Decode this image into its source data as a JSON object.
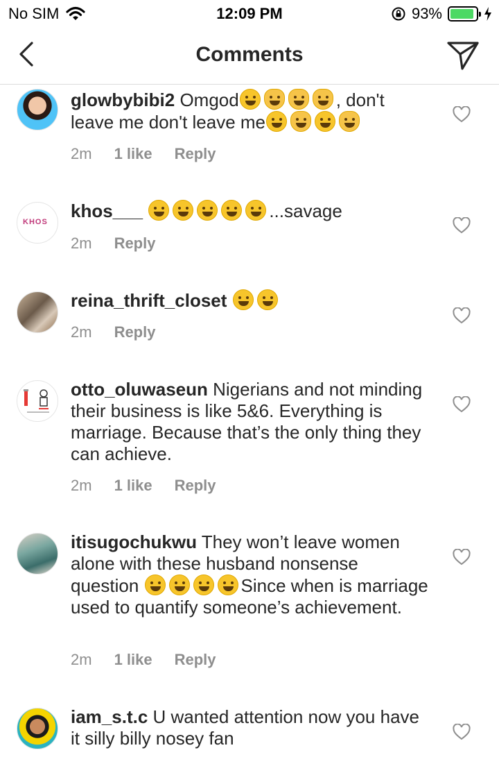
{
  "status_bar": {
    "carrier": "No SIM",
    "time": "12:09 PM",
    "battery_percent": "93%",
    "battery_level": 0.93,
    "battery_color": "#4cd964",
    "icons": [
      "wifi-icon",
      "rotation-lock-icon",
      "battery-icon",
      "charging-bolt-icon"
    ]
  },
  "header": {
    "title": "Comments",
    "back_icon": "chevron-left-icon",
    "send_icon": "paper-plane-icon"
  },
  "colors": {
    "text": "#262626",
    "meta": "#8e8e8e",
    "divider": "#dbdbdb"
  },
  "comments": [
    {
      "username": "glowbybibi2",
      "text_parts": [
        " Omgod",
        "[sob]",
        "[cat]",
        "[cat]",
        "[cat]",
        ", don't leave me don't leave me",
        "[sob]",
        "[cat]",
        "[sob]",
        "[cat]"
      ],
      "time": "2m",
      "likes": "1 like",
      "reply": "Reply"
    },
    {
      "username": "khos___",
      "avatar_text": "KHOS",
      "text_parts": [
        " ",
        "[rofl]",
        "[rofl]",
        "[rofl]",
        "[rofl]",
        "[rofl]",
        "...savage"
      ],
      "time": "2m",
      "likes": "",
      "reply": "Reply"
    },
    {
      "username": "reina_thrift_closet",
      "text_parts": [
        " ",
        "[grin]",
        "[grin]"
      ],
      "time": "2m",
      "likes": "",
      "reply": "Reply"
    },
    {
      "username": "otto_oluwaseun",
      "text_parts": [
        " Nigerians and not minding their business is like 5&6. Everything is marriage. Because that’s the only thing they can achieve."
      ],
      "time": "2m",
      "likes": "1 like",
      "reply": "Reply"
    },
    {
      "username": "itisugochukwu",
      "text_parts": [
        " They won’t leave women alone with these husband nonsense question ",
        "[think]",
        "[think]",
        "[think]",
        "[think]",
        "Since when is marriage used to quantify someone’s achievement."
      ],
      "time": "2m",
      "likes": "1 like",
      "reply": "Reply"
    },
    {
      "username": "iam_s.t.c",
      "text_parts": [
        " U wanted attention now you have it silly billy nosey fan"
      ],
      "time": "",
      "likes": "",
      "reply": ""
    }
  ]
}
